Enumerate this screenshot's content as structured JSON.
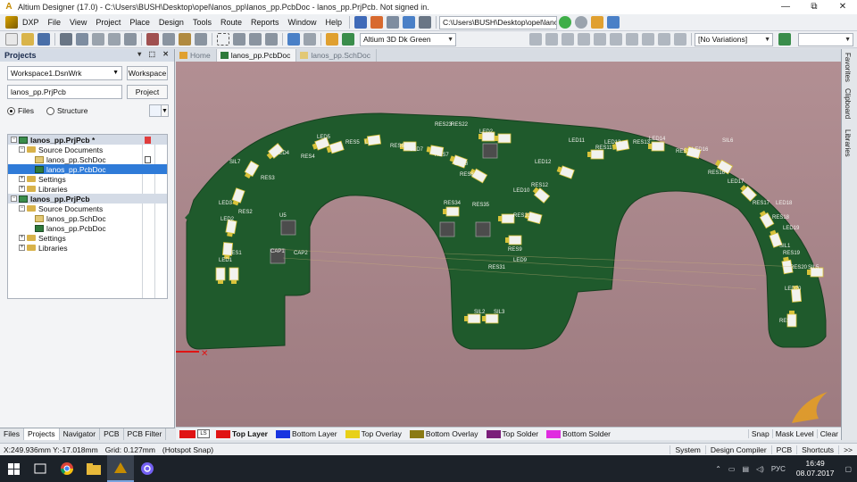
{
  "window": {
    "app_logo_glyph": "A",
    "title": "Altium Designer (17.0) - C:\\Users\\BUSH\\Desktop\\opel\\lanos_pp\\lanos_pp.PcbDoc - lanos_pp.PrjPcb. Not signed in.",
    "controls": [
      "—",
      "⧉",
      "✕"
    ]
  },
  "menu": {
    "items": [
      "DXP",
      "File",
      "View",
      "Project",
      "Place",
      "Design",
      "Tools",
      "Route",
      "Reports",
      "Window",
      "Help"
    ],
    "path": "C:\\Users\\BUSH\\Desktop\\opel\\lano"
  },
  "toolbar": {
    "view_config": "Altium 3D Dk Green",
    "variations": "[No Variations]"
  },
  "projects_panel": {
    "title": "Projects",
    "header_controls": "▾ ⬚ ✕",
    "workspace": "Workspace1.DsnWrk",
    "workspace_button": "Workspace",
    "project_field": "lanos_pp.PrjPcb",
    "project_button": "Project",
    "view_mode_files": "Files",
    "view_mode_structure": "Structure",
    "tree": [
      {
        "label": "lanos_pp.PrjPcb *",
        "kind": "project",
        "indent": 0,
        "expanded": true
      },
      {
        "label": "Source Documents",
        "kind": "folder",
        "indent": 1,
        "expanded": true
      },
      {
        "label": "lanos_pp.SchDoc",
        "kind": "sch",
        "indent": 2
      },
      {
        "label": "lanos_pp.PcbDoc",
        "kind": "pcb",
        "indent": 2,
        "selected": true
      },
      {
        "label": "Settings",
        "kind": "folder",
        "indent": 1,
        "expanded": false
      },
      {
        "label": "Libraries",
        "kind": "folder",
        "indent": 1,
        "expanded": false
      },
      {
        "label": "lanos_pp.PrjPcb",
        "kind": "project",
        "indent": 0,
        "expanded": true
      },
      {
        "label": "Source Documents",
        "kind": "folder",
        "indent": 1,
        "expanded": true
      },
      {
        "label": "lanos_pp.SchDoc",
        "kind": "sch",
        "indent": 2
      },
      {
        "label": "lanos_pp.PcbDoc",
        "kind": "pcb",
        "indent": 2
      },
      {
        "label": "Settings",
        "kind": "folder",
        "indent": 1,
        "expanded": false
      },
      {
        "label": "Libraries",
        "kind": "folder",
        "indent": 1,
        "expanded": false
      }
    ],
    "bottom_tabs": [
      "Files",
      "Projects",
      "Navigator",
      "PCB",
      "PCB Filter"
    ]
  },
  "doc_tabs": [
    {
      "label": "Home",
      "state": "inactive"
    },
    {
      "label": "lanos_pp.PcbDoc",
      "state": "active"
    },
    {
      "label": "lanos_pp.SchDoc",
      "state": "inactive"
    }
  ],
  "right_tabs": [
    "Favorites",
    "Clipboard",
    "Libraries"
  ],
  "pcb_labels": [
    "RES23",
    "RES22",
    "LED2",
    "LED5",
    "RES5",
    "LED6",
    "RES6",
    "LED7",
    "RES7",
    "LED4",
    "RES4",
    "SIL7",
    "RES3",
    "LED3",
    "RES2",
    "LED2",
    "RES1",
    "LED1",
    "U5",
    "CAP1",
    "CAP2",
    "LED8",
    "RES8",
    "RES34",
    "RES35",
    "LED10",
    "RES10",
    "RES9",
    "LED9",
    "RES31",
    "LED12",
    "RES12",
    "LED11",
    "RES11",
    "LED13",
    "RES13",
    "LED14",
    "RES14",
    "LED16",
    "RES16",
    "LED17",
    "RES17",
    "LED18",
    "RES18",
    "LED19",
    "RES19",
    "RES20",
    "LED20",
    "RES21",
    "SIL5",
    "SIL1",
    "SIL2",
    "SIL3",
    "SIL6"
  ],
  "layers": {
    "ls_label": "LS",
    "items": [
      {
        "label": "Top Layer",
        "color": "#e01414",
        "active": true
      },
      {
        "label": "Bottom Layer",
        "color": "#1834e0"
      },
      {
        "label": "Top Overlay",
        "color": "#e8d018"
      },
      {
        "label": "Bottom Overlay",
        "color": "#8a7a14"
      },
      {
        "label": "Top Solder",
        "color": "#7a1e7a"
      },
      {
        "label": "Bottom Solder",
        "color": "#e02ce0"
      }
    ],
    "right": [
      "Snap",
      "Mask Level",
      "Clear"
    ]
  },
  "status": {
    "coords": "X:249.936mm Y:-17.018mm",
    "grid": "Grid: 0.127mm",
    "snap": "(Hotspot Snap)",
    "right": [
      "System",
      "Design Compiler",
      "PCB",
      "Shortcuts",
      ">>"
    ]
  },
  "taskbar": {
    "lang": "РУС",
    "time": "16:49",
    "date": "08.07.2017"
  }
}
